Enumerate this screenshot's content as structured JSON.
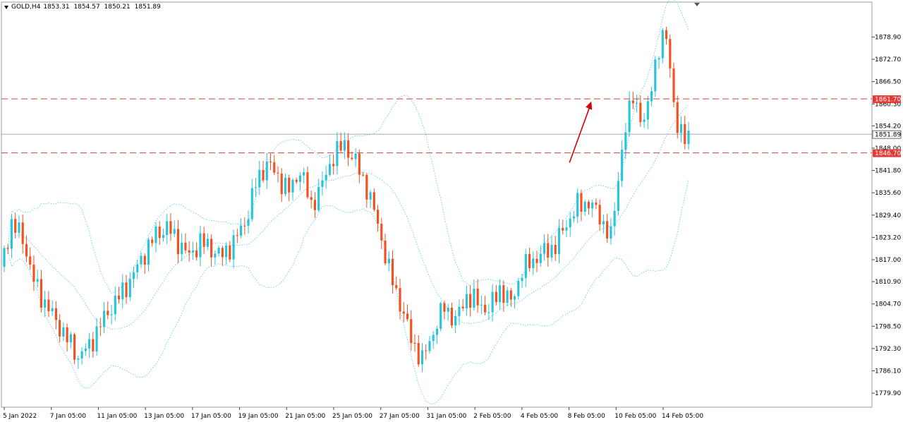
{
  "header": {
    "symbol": "GOLD,H4",
    "open": "1853.31",
    "high": "1854.57",
    "low": "1850.21",
    "close": "1851.89"
  },
  "colors": {
    "bull": "#26c6da",
    "bear": "#f4511e",
    "level": "#e53935",
    "arrow": "#d50000",
    "band": "#4fc3f7",
    "price_line": "#8a9099"
  },
  "chart_data": {
    "type": "candlestick",
    "ylim": [
      1776.0,
      1888.6
    ],
    "y_ticks": [
      "1878.90",
      "1872.70",
      "1866.50",
      "1860.30",
      "1854.20",
      "1848.00",
      "1841.80",
      "1835.60",
      "1829.40",
      "1823.20",
      "1817.00",
      "1810.90",
      "1804.70",
      "1798.50",
      "1792.30",
      "1786.10",
      "1779.90"
    ],
    "x_tick_labels": [
      "5 Jan 2022",
      "7 Jan 05:00",
      "11 Jan 05:00",
      "13 Jan 05:00",
      "17 Jan 05:00",
      "19 Jan 05:00",
      "21 Jan 05:00",
      "25 Jan 05:00",
      "27 Jan 05:00",
      "31 Jan 05:00",
      "2 Feb 05:00",
      "4 Feb 05:00",
      "8 Feb 05:00",
      "10 Feb 05:00",
      "14 Feb 05:00"
    ],
    "levels": [
      {
        "label": "1861.70",
        "value": 1861.7
      },
      {
        "label": "1846.70",
        "value": 1846.7
      }
    ],
    "current_price": {
      "label": "1851.89",
      "value": 1851.89
    },
    "annotation": {
      "type": "arrow",
      "from": [
        149,
        1844.0
      ],
      "to": [
        153,
        1861.0
      ]
    },
    "close_path": [
      1815,
      1827,
      1823,
      1811,
      1805,
      1800,
      1795,
      1790,
      1793,
      1799,
      1804,
      1808,
      1813,
      1819,
      1824,
      1826,
      1822,
      1818,
      1822,
      1820,
      1818,
      1822,
      1827,
      1838,
      1844,
      1840,
      1836,
      1842,
      1832,
      1838,
      1846,
      1849,
      1844,
      1837,
      1827,
      1814,
      1805,
      1795,
      1789,
      1797,
      1804,
      1800,
      1807,
      1805,
      1803,
      1809,
      1805,
      1814,
      1817,
      1819,
      1821,
      1827,
      1832,
      1833,
      1829,
      1823,
      1848,
      1863,
      1854,
      1872,
      1880,
      1852,
      1852
    ],
    "segments_per_step": 3
  }
}
